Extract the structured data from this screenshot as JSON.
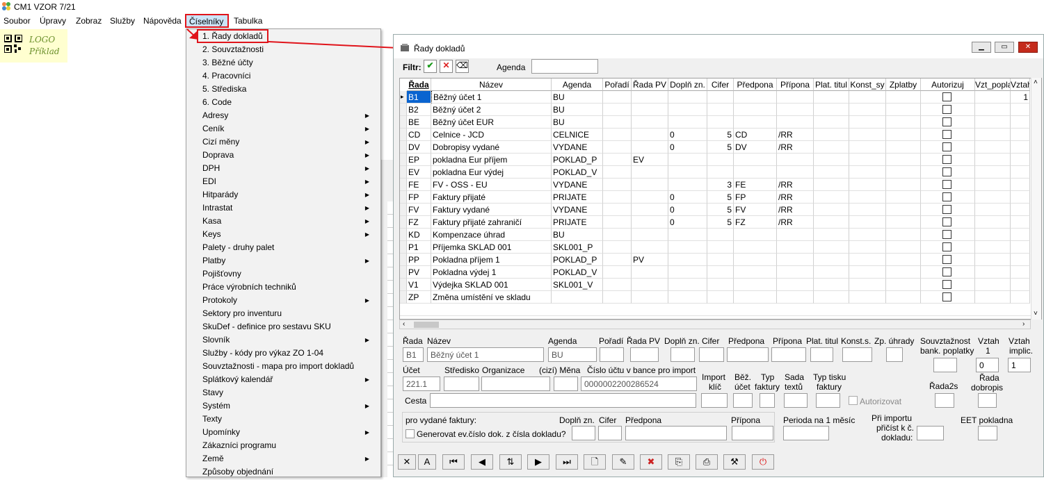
{
  "app": {
    "title": "CM1 VZOR 7/21"
  },
  "menubar": [
    "Soubor",
    "Úpravy",
    "Zobraz",
    "Služby",
    "Nápověda",
    "Číselníky",
    "Tabulka"
  ],
  "logo": {
    "line1": "LOGO",
    "line2": "Příklad"
  },
  "dropdown": [
    {
      "label": "1. Řady dokladů",
      "sub": false
    },
    {
      "label": "2. Souvztažnosti",
      "sub": false
    },
    {
      "label": "3. Běžné účty",
      "sub": false
    },
    {
      "label": "4. Pracovníci",
      "sub": false
    },
    {
      "label": "5. Střediska",
      "sub": false
    },
    {
      "label": "6. Code",
      "sub": false
    },
    {
      "label": "Adresy",
      "sub": true
    },
    {
      "label": "Ceník",
      "sub": true
    },
    {
      "label": "Cizí měny",
      "sub": true
    },
    {
      "label": "Doprava",
      "sub": true
    },
    {
      "label": "DPH",
      "sub": true
    },
    {
      "label": "EDI",
      "sub": true
    },
    {
      "label": "Hitparády",
      "sub": true
    },
    {
      "label": "Intrastat",
      "sub": true
    },
    {
      "label": "Kasa",
      "sub": true
    },
    {
      "label": "Keys",
      "sub": true
    },
    {
      "label": "Palety - druhy palet",
      "sub": false
    },
    {
      "label": "Platby",
      "sub": true
    },
    {
      "label": "Pojišťovny",
      "sub": false
    },
    {
      "label": "Práce výrobních techniků",
      "sub": false
    },
    {
      "label": "Protokoly",
      "sub": true
    },
    {
      "label": "Sektory pro inventuru",
      "sub": false
    },
    {
      "label": "SkuDef - definice pro sestavu SKU",
      "sub": false
    },
    {
      "label": "Slovník",
      "sub": true
    },
    {
      "label": "Služby - kódy pro výkaz ZO 1-04",
      "sub": false
    },
    {
      "label": "Souvztažnosti - mapa pro import dokladů",
      "sub": false
    },
    {
      "label": "Splátkový kalendář",
      "sub": true
    },
    {
      "label": "Stavy",
      "sub": false
    },
    {
      "label": "Systém",
      "sub": true
    },
    {
      "label": "Texty",
      "sub": false
    },
    {
      "label": "Upomínky",
      "sub": true
    },
    {
      "label": "Zákazníci programu",
      "sub": false
    },
    {
      "label": "Země",
      "sub": true
    },
    {
      "label": "Způsoby objednání",
      "sub": false
    }
  ],
  "window": {
    "title": "Řady dokladů",
    "filter_label": "Filtr:",
    "agenda_label": "Agenda",
    "agenda_value": "",
    "columns": [
      "Řada",
      "Název",
      "Agenda",
      "Pořadí",
      "Řada PV",
      "Doplň zn.",
      "Cifer",
      "Předpona",
      "Přípona",
      "Plat. titul",
      "Konst_sy",
      "Zplatby",
      "Autorizuj",
      "Vzt_popla",
      "Vztah"
    ],
    "rows": [
      [
        "B1",
        "Běžný účet 1",
        "BU",
        "",
        "",
        "",
        "",
        "",
        "",
        "",
        "",
        "",
        "",
        "",
        "1"
      ],
      [
        "B2",
        "Běžný účet 2",
        "BU",
        "",
        "",
        "",
        "",
        "",
        "",
        "",
        "",
        "",
        "",
        "",
        ""
      ],
      [
        "BE",
        "Běžný účet EUR",
        "BU",
        "",
        "",
        "",
        "",
        "",
        "",
        "",
        "",
        "",
        "",
        "",
        ""
      ],
      [
        "CD",
        "Celnice - JCD",
        "CELNICE",
        "",
        "",
        "0",
        "5",
        "CD",
        "/RR",
        "",
        "",
        "",
        "",
        "",
        ""
      ],
      [
        "DV",
        "Dobropisy vydané",
        "VYDANE",
        "",
        "",
        "0",
        "5",
        "DV",
        "/RR",
        "",
        "",
        "",
        "",
        "",
        ""
      ],
      [
        "EP",
        "pokladna Eur příjem",
        "POKLAD_P",
        "",
        "EV",
        "",
        "",
        "",
        "",
        "",
        "",
        "",
        "",
        "",
        ""
      ],
      [
        "EV",
        "pokladna Eur výdej",
        "POKLAD_V",
        "",
        "",
        "",
        "",
        "",
        "",
        "",
        "",
        "",
        "",
        "",
        ""
      ],
      [
        "FE",
        "FV - OSS - EU",
        "VYDANE",
        "",
        "",
        "",
        "3",
        "FE",
        "/RR",
        "",
        "",
        "",
        "",
        "",
        ""
      ],
      [
        "FP",
        "Faktury přijaté",
        "PRIJATE",
        "",
        "",
        "0",
        "5",
        "FP",
        "/RR",
        "",
        "",
        "",
        "",
        "",
        ""
      ],
      [
        "FV",
        "Faktury vydané",
        "VYDANE",
        "",
        "",
        "0",
        "5",
        "FV",
        "/RR",
        "",
        "",
        "",
        "",
        "",
        ""
      ],
      [
        "FZ",
        "Faktury přijaté zahraničí",
        "PRIJATE",
        "",
        "",
        "0",
        "5",
        "FZ",
        "/RR",
        "",
        "",
        "",
        "",
        "",
        ""
      ],
      [
        "KD",
        "Kompenzace úhrad",
        "BU",
        "",
        "",
        "",
        "",
        "",
        "",
        "",
        "",
        "",
        "",
        "",
        ""
      ],
      [
        "P1",
        "Příjemka SKLAD 001",
        "SKL001_P",
        "",
        "",
        "",
        "",
        "",
        "",
        "",
        "",
        "",
        "",
        "",
        ""
      ],
      [
        "PP",
        "Pokladna příjem 1",
        "POKLAD_P",
        "",
        "PV",
        "",
        "",
        "",
        "",
        "",
        "",
        "",
        "",
        "",
        ""
      ],
      [
        "PV",
        "Pokladna výdej  1",
        "POKLAD_V",
        "",
        "",
        "",
        "",
        "",
        "",
        "",
        "",
        "",
        "",
        "",
        ""
      ],
      [
        "V1",
        "Výdejka  SKLAD 001",
        "SKL001_V",
        "",
        "",
        "",
        "",
        "",
        "",
        "",
        "",
        "",
        "",
        "",
        ""
      ],
      [
        "ZP",
        "Změna umístění ve skladu",
        "",
        "",
        "",
        "",
        "",
        "",
        "",
        "",
        "",
        "",
        "",
        "",
        ""
      ]
    ],
    "detail": {
      "rada_label": "Řada",
      "rada": "B1",
      "nazev_label": "Název",
      "nazev": "Běžný účet 1",
      "agenda_label": "Agenda",
      "agenda": "BU",
      "poradi_label": "Pořadí",
      "radapv_label": "Řada PV",
      "doplnzn_label": "Doplň zn.",
      "cifer_label": "Cifer",
      "predpona_label": "Předpona",
      "pripona_label": "Přípona",
      "plattitul_label": "Plat. titul",
      "konsts_label": "Konst.s.",
      "zpuhrady_label": "Zp. úhrady",
      "souvz_label1": "Souvztažnost",
      "souvz_label2": "bank. poplatky",
      "vztah_label": "Vztah",
      "vztah_num": "1",
      "vztah_value": "0",
      "vztahimp_label1": "Vztah",
      "vztahimp_label2": "implic.",
      "vztahimp_value": "1",
      "ucet_label": "Účet",
      "ucet": "221.1",
      "stredisko_label": "Středisko",
      "organizace_label": "Organizace",
      "mena_label": "(cizí) Měna",
      "cislo_label": "Číslo účtu v bance pro import",
      "cislo": "0000002200286524",
      "import_label1": "Import",
      "import_label2": "klíč",
      "bez_label1": "Běž.",
      "bez_label2": "účet",
      "typ_label1": "Typ",
      "typ_label2": "faktury",
      "sada_label1": "Sada",
      "sada_label2": "textů",
      "typtisku_label1": "Typ tisku",
      "typtisku_label2": "faktury",
      "rada2s_label": "Řada2s",
      "radadob_label1": "Řada",
      "radadob_label2": "dobropis",
      "cesta_label": "Cesta",
      "autoriz_label": "Autorizovat",
      "vydane_label": "pro vydané faktury:",
      "generovat_label": "Generovat ev.číslo dok. z čísla dokladu?",
      "doplnzn2_label": "Doplň zn.",
      "cifer2_label": "Cifer",
      "predpona2_label": "Předpona",
      "pripona2_label": "Přípona",
      "perioda_label": "Perioda na 1 měsíc",
      "priimportu_label1": "Při importu",
      "priimportu_label2": "přičíst k č.",
      "priimportu_label3": "dokladu:",
      "eet_label": "EET pokladna"
    }
  }
}
